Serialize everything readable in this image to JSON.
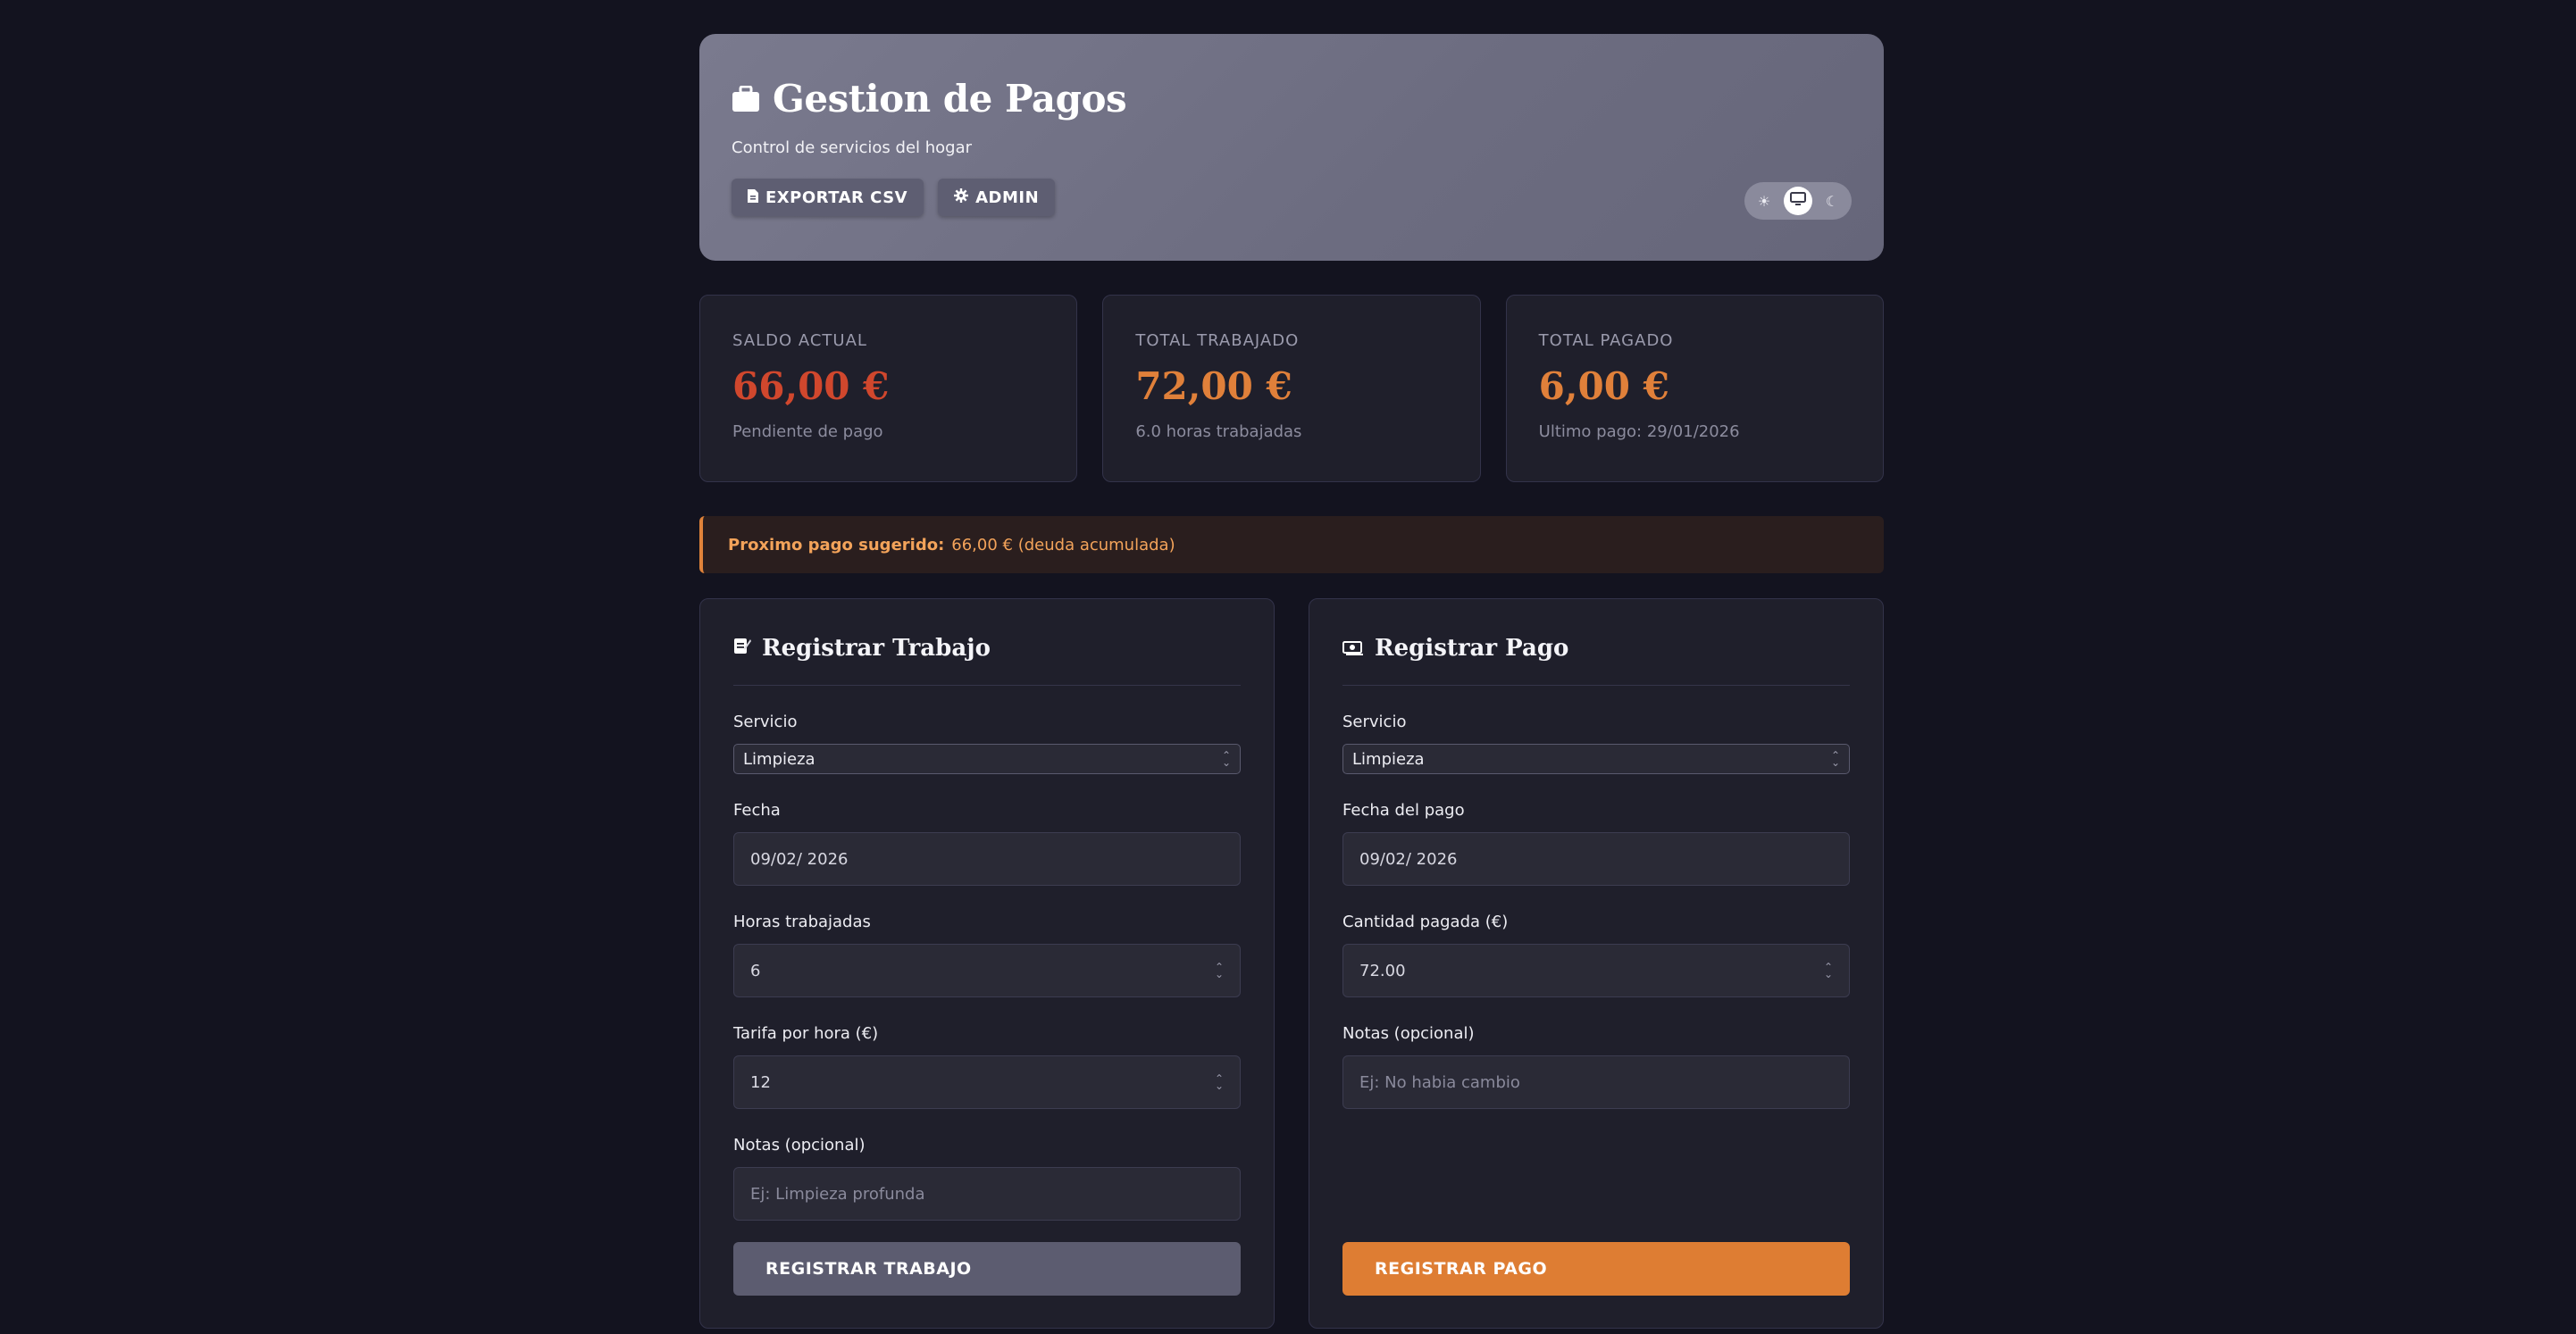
{
  "header": {
    "title": "Gestion de Pagos",
    "subtitle": "Control de servicios del hogar",
    "export_label": "EXPORTAR CSV",
    "admin_label": "ADMIN",
    "title_icon": "briefcase-icon",
    "theme_options": [
      {
        "name": "sun-icon",
        "glyph": "☀",
        "active": false
      },
      {
        "name": "monitor-icon",
        "glyph": "▭",
        "active": true
      },
      {
        "name": "moon-icon",
        "glyph": "☾",
        "active": false
      }
    ]
  },
  "stats": [
    {
      "label": "SALDO ACTUAL",
      "value": "66,00 €",
      "sub": "Pendiente de pago",
      "color": "#d0472d"
    },
    {
      "label": "TOTAL TRABAJADO",
      "value": "72,00 €",
      "sub": "6.0 horas trabajadas",
      "color": "#e0803a"
    },
    {
      "label": "TOTAL PAGADO",
      "value": "6,00 €",
      "sub": "Ultimo pago: 29/01/2026",
      "color": "#e0803a"
    }
  ],
  "alert": {
    "bold": "Proximo pago sugerido:",
    "text": "66,00 € (deuda acumulada)"
  },
  "work_form": {
    "title": "Registrar Trabajo",
    "service_label": "Servicio",
    "service_value": "Limpieza",
    "date_label": "Fecha",
    "date_value": "09/02/ 2026",
    "hours_label": "Horas trabajadas",
    "hours_value": "6",
    "rate_label": "Tarifa por hora (€)",
    "rate_value": "12",
    "notes_label": "Notas (opcional)",
    "notes_placeholder": "Ej: Limpieza profunda",
    "submit_label": "REGISTRAR TRABAJO"
  },
  "payment_form": {
    "title": "Registrar Pago",
    "service_label": "Servicio",
    "service_value": "Limpieza",
    "date_label": "Fecha del pago",
    "date_value": "09/02/ 2026",
    "amount_label": "Cantidad pagada (€)",
    "amount_value": "72.00",
    "notes_label": "Notas (opcional)",
    "notes_placeholder": "Ej: No habia cambio",
    "submit_label": "REGISTRAR PAGO"
  },
  "colors": {
    "accent": "#de7d33",
    "danger": "#d0472d"
  }
}
